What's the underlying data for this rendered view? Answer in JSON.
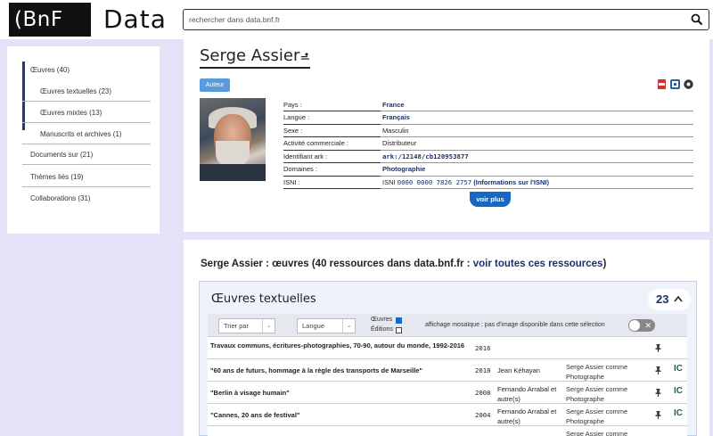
{
  "header": {
    "logo_main": "(BnF",
    "logo_sub": "Data",
    "search_placeholder": "rechercher dans data.bnf.fr"
  },
  "sidebar": {
    "items": [
      {
        "label": "Œuvres (40)"
      },
      {
        "label": "Œuvres textuelles (23)"
      },
      {
        "label": "Œuvres mixtes (13)"
      },
      {
        "label": "Manuscrits et archives (1)"
      },
      {
        "label": "Documents sur (21)"
      },
      {
        "label": "Thèmes liés (19)"
      },
      {
        "label": "Collaborations (31)"
      }
    ]
  },
  "person": {
    "name": "Serge Assier",
    "role_badge": "Auteur",
    "fields": [
      {
        "key": "Pays :",
        "value": "France"
      },
      {
        "key": "Langue :",
        "value": "Français"
      },
      {
        "key": "Sexe :",
        "value": "Masculin"
      },
      {
        "key": "Activité commerciale :",
        "value": "Distributeur"
      },
      {
        "key": "Identifiant ark :",
        "value": "ark:/12148/cb120953877"
      },
      {
        "key": "Domaines :",
        "value": "Photographie"
      },
      {
        "key": "ISNI :",
        "value_prefix": "ISNI",
        "value": "0000 0000 7826 2757",
        "value_link": "(Informations sur l'ISNI)"
      }
    ],
    "voir_plus": "voir plus"
  },
  "works": {
    "heading_text": "Serge Assier : œuvres (40 ressources dans data.bnf.fr : ",
    "heading_link": "voir toutes ces ressources",
    "heading_end": ")",
    "section_title": "Œuvres textuelles",
    "count": "23",
    "filters": {
      "sort_label": "Trier par",
      "lang_label": "Langue",
      "oeuvres_label": "Œuvres",
      "editions_label": "Éditions",
      "mosaic_label": "affichage mosaïque : pas d'image disponible dans cette sélection"
    },
    "rows": [
      {
        "title": "Travaux communs, écritures-photographies, 70-90, autour du monde, 1992-2016",
        "year": "2016",
        "author": "",
        "role": "",
        "ic": ""
      },
      {
        "title": "\"60 ans de futurs, hommage à la règle des transports de Marseille\"",
        "year": "2010",
        "author": "Jean Kéhayan",
        "role": "Serge Assier comme Photographe",
        "ic": "IC"
      },
      {
        "title": "\"Berlin à visage humain\"",
        "year": "2008",
        "author": "Fernando Arrabal et autre(s)",
        "role": "Serge Assier comme Photographe",
        "ic": "IC"
      },
      {
        "title": "\"Cannes, 20 ans de festival\"",
        "year": "2004",
        "author": "Fernando Arrabal et autre(s)",
        "role": "Serge Assier comme Photographe",
        "ic": "IC"
      },
      {
        "title": "",
        "year": "",
        "author": "",
        "role": "Serge Assier comme",
        "ic": ""
      }
    ]
  }
}
